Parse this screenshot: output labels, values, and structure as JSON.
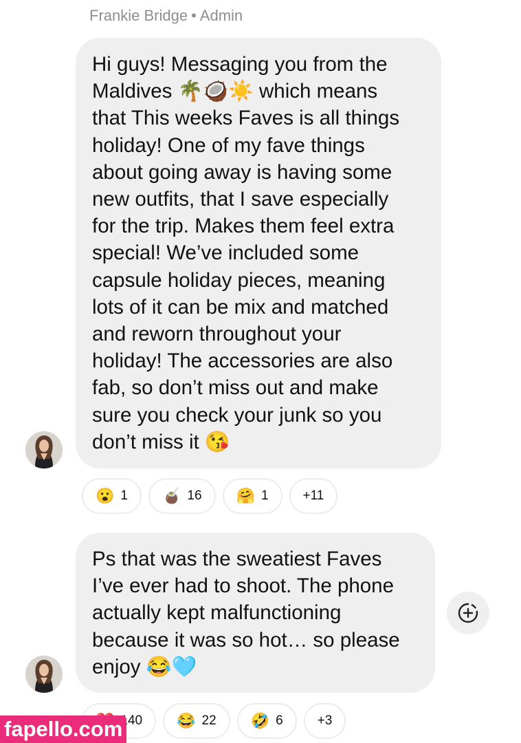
{
  "header": {
    "sender_name": "Frankie Bridge",
    "separator": "•",
    "sender_role": "Admin"
  },
  "messages": [
    {
      "text": "Hi guys! Messaging you from the\nMaldives 🌴🥥☀️ which means\nthat This weeks Faves is all things\nholiday! One of my fave things\nabout going away is having some\nnew outfits, that I save especially\nfor the trip. Makes them feel extra\nspecial! We’ve included some\ncapsule holiday pieces, meaning\nlots of it can be mix and matched\nand reworn throughout your\nholiday! The accessories are also\nfab, so don’t miss out and make\nsure you check your junk so you\ndon’t miss it 😘",
      "reactions": [
        {
          "emoji": "😮",
          "count": "1"
        },
        {
          "emoji": "🧉",
          "count": "16"
        },
        {
          "emoji": "🤗",
          "count": "1"
        },
        {
          "emoji": "",
          "count": "+11"
        }
      ]
    },
    {
      "text": "Ps that was the sweatiest Faves\nI’ve ever had to shoot. The phone\nactually kept malfunctioning\nbecause it was so hot… so please\nenjoy 😂🩵",
      "reactions": [
        {
          "emoji": "❤️",
          "count": "140"
        },
        {
          "emoji": "😂",
          "count": "22"
        },
        {
          "emoji": "🤣",
          "count": "6"
        },
        {
          "emoji": "",
          "count": "+3"
        }
      ]
    }
  ],
  "icons": {
    "add_reaction": "add-reaction-icon",
    "avatar": "profile-photo"
  },
  "watermark": "fapello.com",
  "colors": {
    "bubble": "#efefef",
    "meta_text": "#8e8e8e",
    "watermark_bg": "#ea2c7a"
  }
}
